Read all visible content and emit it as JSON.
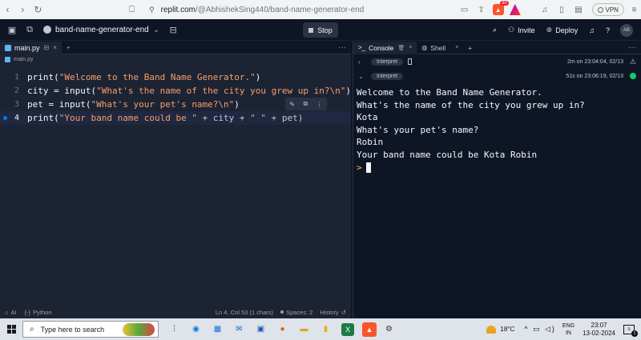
{
  "browser": {
    "url_host": "replit.com",
    "url_path": "/@AbhishekSing440/band-name-generator-end",
    "vpn_label": "VPN",
    "brave_badge": "30"
  },
  "header": {
    "repl_name": "band-name-generator-end",
    "stop_label": "Stop",
    "invite_label": "Invite",
    "deploy_label": "Deploy",
    "avatar_initials": "AB"
  },
  "editor": {
    "tab_label": "main.py",
    "breadcrumb": "main.py",
    "lines": [
      {
        "num": "1",
        "parts": [
          {
            "t": "print(",
            "c": "fn"
          },
          {
            "t": "\"Welcome to the Band Name Generator.\"",
            "c": "str"
          },
          {
            "t": ")",
            "c": "fn"
          }
        ]
      },
      {
        "num": "2",
        "parts": [
          {
            "t": "city = input(",
            "c": "fn"
          },
          {
            "t": "\"What's the name of the city you grew up in?\\n\"",
            "c": "str"
          },
          {
            "t": ")",
            "c": "fn"
          }
        ]
      },
      {
        "num": "3",
        "parts": [
          {
            "t": "pet = input(",
            "c": "fn"
          },
          {
            "t": "\"What's your pet's name?\\n\"",
            "c": "str"
          },
          {
            "t": ")",
            "c": "fn"
          }
        ]
      },
      {
        "num": "4",
        "parts": [
          {
            "t": "print(",
            "c": "fn"
          },
          {
            "t": "\"Your band name could be \"",
            "c": "str"
          },
          {
            "t": " + city + ",
            "c": "op"
          },
          {
            "t": "\" \"",
            "c": "str"
          },
          {
            "t": " + pet)",
            "c": "op"
          }
        ]
      }
    ]
  },
  "status_bar": {
    "ai": "AI",
    "language": "Python",
    "cursor_pos": "Ln 4, Col 53 (1 chars)",
    "spaces": "Spaces: 2",
    "history": "History"
  },
  "console": {
    "tab_console": "Console",
    "tab_shell": "Shell",
    "runs": [
      {
        "label": "Interpret",
        "time": "2m on 23:04:04, 02/13"
      },
      {
        "label": "Interpret",
        "time": "51s on 23:06:19, 02/13"
      }
    ],
    "output": [
      "Welcome to the Band Name Generator.",
      "What's the name of the city you grew up in?",
      "Kota",
      "What's your pet's name?",
      "Robin",
      "Your band name could be Kota Robin"
    ],
    "prompt_symbol": ">"
  },
  "taskbar": {
    "search_placeholder": "Type here to search",
    "temperature": "18°C",
    "lang_top": "ENG",
    "lang_bottom": "IN",
    "time": "23:07",
    "date": "13-02-2024",
    "notification_count": "1"
  }
}
